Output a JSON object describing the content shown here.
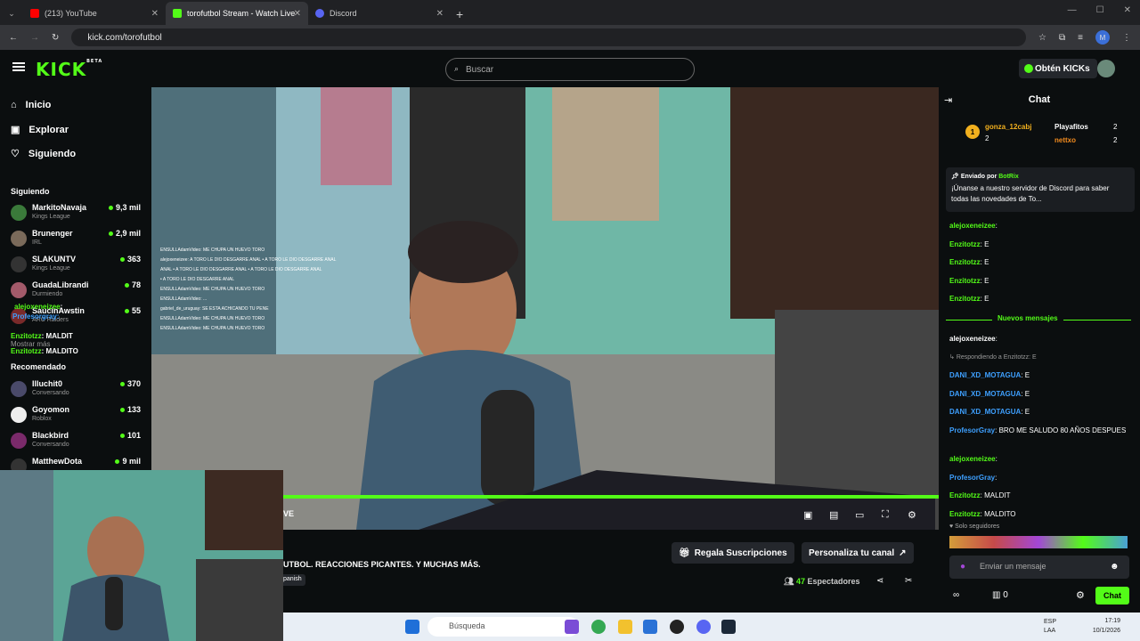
{
  "browser": {
    "tabs": [
      {
        "label": "(213) YouTube",
        "color": "#ff0000"
      },
      {
        "label": "torofutbol Stream - Watch Live",
        "color": "#53fc18"
      },
      {
        "label": "Discord",
        "color": "#5865f2"
      }
    ],
    "url": "kick.com/torofutbol",
    "profile_initial": "M"
  },
  "kick": {
    "logo": "KICK",
    "logo_badge": "BETA",
    "search_placeholder": "Buscar",
    "get_kicks": "Obtén KICKs"
  },
  "sidebar": {
    "nav": [
      {
        "label": "Inicio",
        "icon": "home-icon"
      },
      {
        "label": "Explorar",
        "icon": "compass-icon"
      },
      {
        "label": "Siguiendo",
        "icon": "heart-icon"
      }
    ],
    "following_title": "Siguiendo",
    "following": [
      {
        "name": "MarkitoNavaja",
        "sub": "Kings League",
        "viewers": "9,3 mil",
        "color": "#3a7a3a"
      },
      {
        "name": "Brunenger",
        "sub": "IRL",
        "viewers": "2,9 mil",
        "color": "#7a6a5a"
      },
      {
        "name": "SLAKUNTV",
        "sub": "Kings League",
        "viewers": "363",
        "color": "#333"
      },
      {
        "name": "GuadaLibrandi",
        "sub": "Durmiendo",
        "viewers": "78",
        "color": "#a35a6a"
      },
      {
        "name": "SaucinAwstin",
        "sub": "ARC Raiders",
        "viewers": "55",
        "color": "#7a2a2a"
      }
    ],
    "show_more": "Mostrar más",
    "recommended_title": "Recomendado",
    "recommended": [
      {
        "name": "Illuchit0",
        "sub": "Conversando",
        "viewers": "370",
        "color": "#4a4a6a"
      },
      {
        "name": "Goyomon",
        "sub": "Roblox",
        "viewers": "133",
        "color": "#eee"
      },
      {
        "name": "Blackbird",
        "sub": "Conversando",
        "viewers": "101",
        "color": "#7a2a6a"
      },
      {
        "name": "MatthewDota",
        "sub": "",
        "viewers": "9 mil",
        "color": "#333"
      }
    ],
    "overlay_chat": [
      {
        "user": "alejoxeneizee",
        "text": ":"
      },
      {
        "user": "Profesorgray",
        "text": ":"
      },
      {
        "user": "Enzitotzz",
        "text": ": MALDIT"
      },
      {
        "user": "Enzitotzz",
        "text": ": MALDITO"
      }
    ]
  },
  "video": {
    "overlay_chat": [
      "ENSULLAdamVideo: ME CHUPA UN HUEVO TORO",
      "alejoxeneizee: A TORO LE DIO DESGARRE ANAL • A TORO LE DIO DESGARRE ANAL",
      "ANAL • A TORO LE DIO DESGARRE ANAL • A TORO LE DIO DESGARRE ANAL",
      "• A TORO LE DIO DESGARRE ANAL",
      "ENSULLAdamVideo: ME CHUPA UN HUEVO TORO",
      "ENSULLAdamVideo: ...",
      "gabriel_de_uruguay: SE ESTA ACHICANDO TU PENE",
      "ENSULLAdamVideo: ME CHUPA UN HUEVO TORO",
      "ENSULLAdamVideo: ME CHUPA UN HUEVO TORO"
    ],
    "live_label": "VE",
    "description": "UTBOL. REACCIONES PICANTES. Y MUCHAS MÁS.",
    "language": "panish",
    "gift_subs": "Regala Suscripciones",
    "customize": "Personaliza tu canal",
    "viewers_count": "47",
    "viewers_label": "Espectadores"
  },
  "chat": {
    "title": "Chat",
    "leaderboard": [
      {
        "rank": "1",
        "user": "gonza_12cabj",
        "count": "2"
      },
      {
        "user": "Playafitos",
        "count": "2"
      },
      {
        "user": "nettxo",
        "count": "2"
      }
    ],
    "pinned": {
      "prefix": "Enviado por",
      "author": "BotRix",
      "text": "¡Únanse a nuestro servidor de Discord para saber todas las novedades de To..."
    },
    "messages_before": [
      {
        "user": "alejoxeneizee",
        "text": ":",
        "cls": "u-green"
      },
      {
        "user": "Enzitotzz",
        "text": ": E",
        "cls": "u-green"
      },
      {
        "user": "Enzitotzz",
        "text": ": E",
        "cls": "u-green"
      },
      {
        "user": "Enzitotzz",
        "text": ": E",
        "cls": "u-green"
      },
      {
        "user": "Enzitotzz",
        "text": ": E",
        "cls": "u-green"
      }
    ],
    "new_messages": "Nuevos mensajes",
    "messages_after": [
      {
        "user": "alejoxeneizee",
        "text": ":",
        "cls": "u-white"
      },
      {
        "user": "Respondiendo a Enzitotzz: E",
        "text": "",
        "cls": "reply"
      },
      {
        "user": "DANI_XD_MOTAGUA",
        "text": ": E",
        "cls": "u-blue"
      },
      {
        "user": "DANI_XD_MOTAGUA",
        "text": ": E",
        "cls": "u-blue"
      },
      {
        "user": "DANI_XD_MOTAGUA",
        "text": ": E",
        "cls": "u-blue"
      },
      {
        "user": "ProfesorGray",
        "text": ": BRO ME SALUDO 80 AÑOS DESPUES",
        "cls": "u-blue"
      },
      {
        "user": "alejoxeneizee",
        "text": ":",
        "cls": "u-green"
      },
      {
        "user": "ProfesorGray",
        "text": ":",
        "cls": "u-blue"
      },
      {
        "user": "Enzitotzz",
        "text": ": MALDIT",
        "cls": "u-green"
      },
      {
        "user": "Enzitotzz",
        "text": ": MALDITO",
        "cls": "u-green"
      }
    ],
    "followers_only": "Solo seguidores",
    "input_placeholder": "Enviar un mensaje",
    "kicks_count": "0",
    "send_label": "Chat"
  },
  "taskbar": {
    "search_placeholder": "Búsqueda",
    "lang1": "ESP",
    "lang2": "LAA",
    "time": "17:19",
    "date": "10/1/2026"
  }
}
